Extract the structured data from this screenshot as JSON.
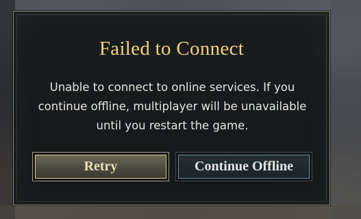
{
  "dialog": {
    "title": "Failed to Connect",
    "message": "Unable to connect to online services. If you continue offline, multiplayer will be unavailable until you restart the game."
  },
  "buttons": {
    "retry_label": "Retry",
    "continue_label": "Continue Offline"
  },
  "colors": {
    "title": "#f1d37a",
    "retry_border": "#d6ca93",
    "continue_border": "#6b8e95"
  }
}
